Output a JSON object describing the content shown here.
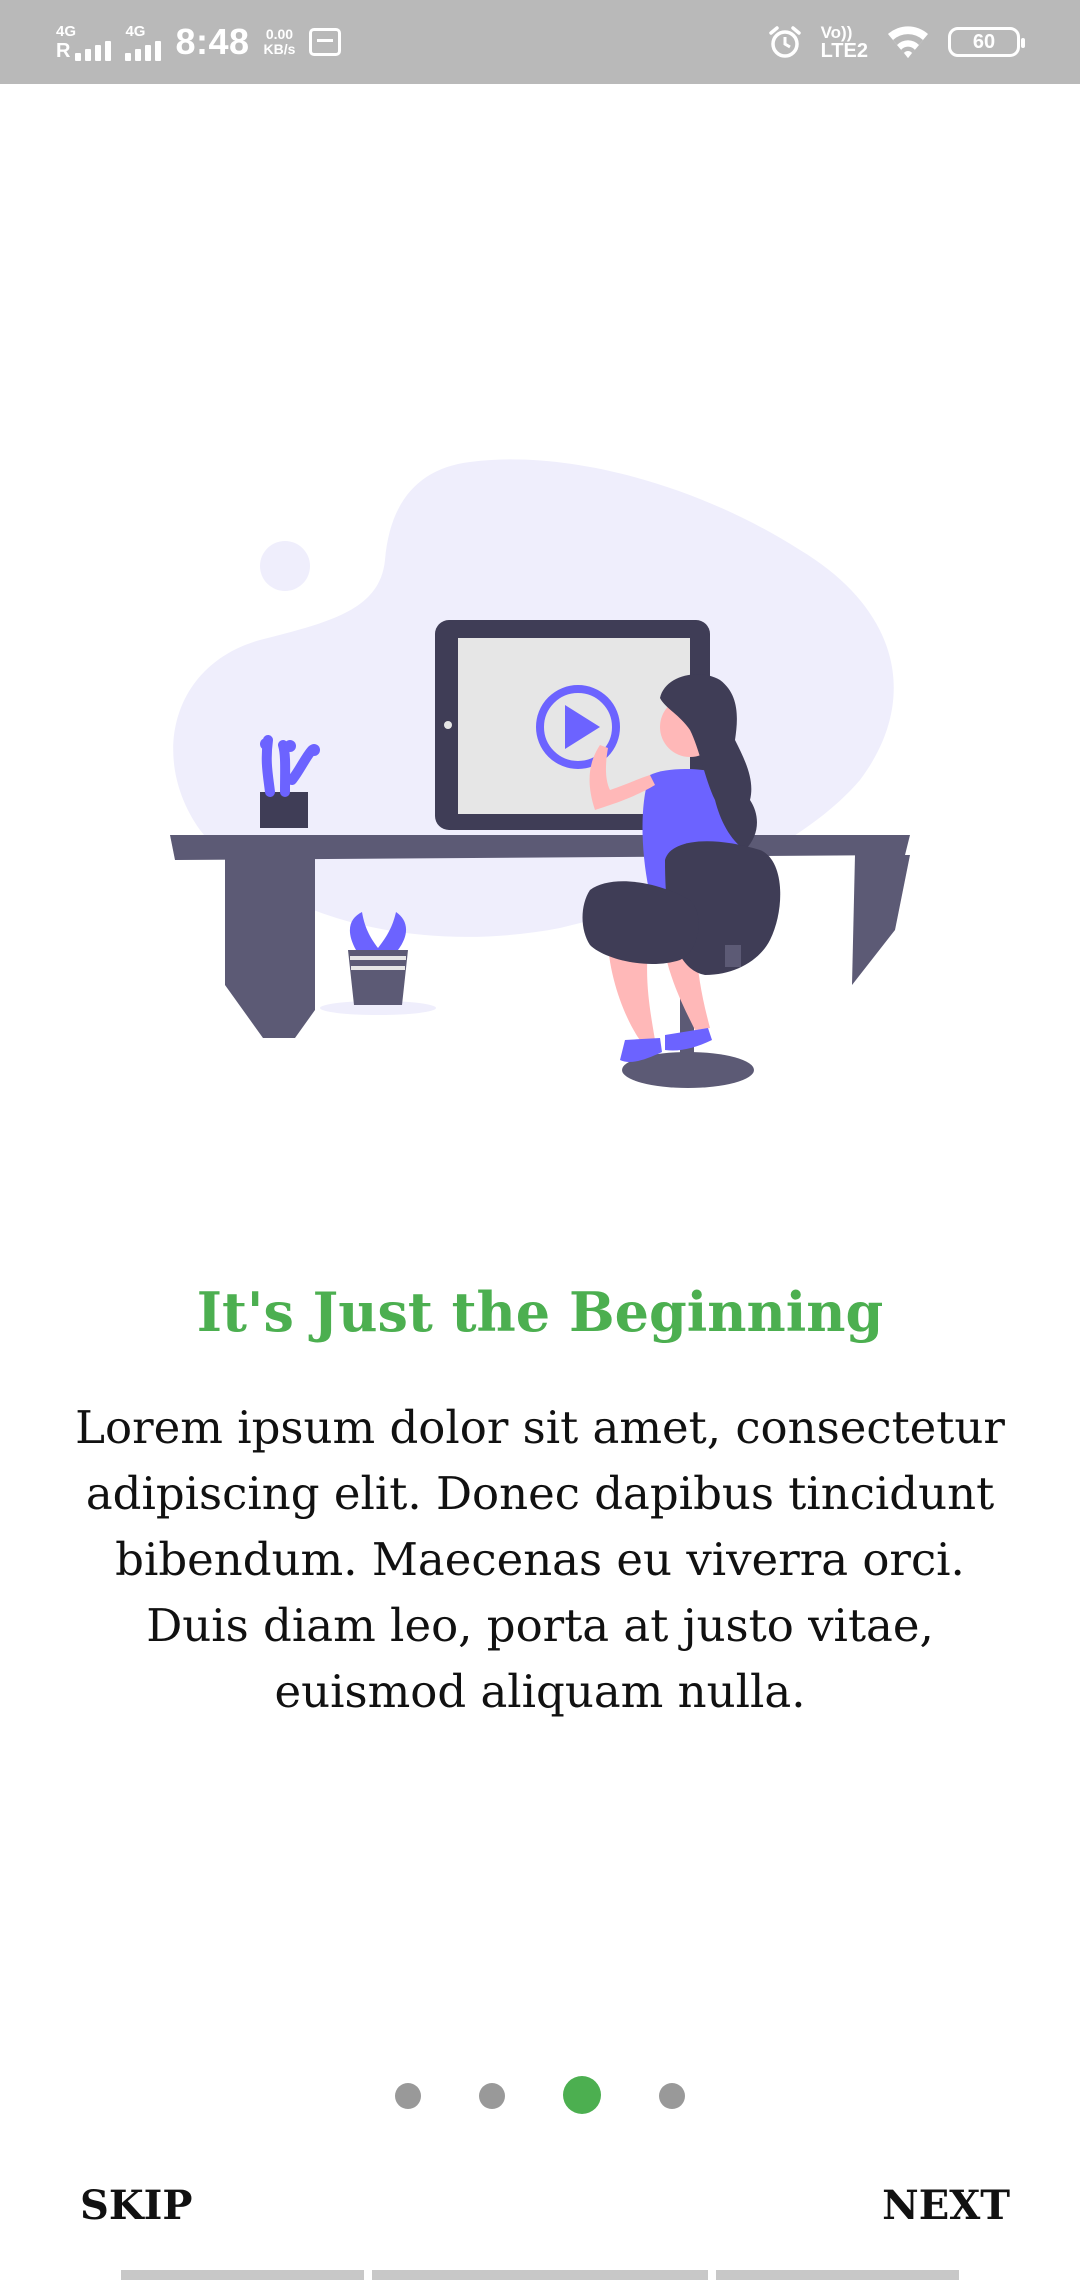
{
  "status_bar": {
    "net1_label": "4G",
    "net1_roaming": "R",
    "net2_label": "4G",
    "time": "8:48",
    "speed_value": "0.00",
    "speed_unit": "KB/s",
    "volte_top": "Vo))",
    "volte_bottom": "LTE2",
    "battery": "60"
  },
  "onboarding": {
    "title": "It's Just the Beginning",
    "body": "Lorem ipsum dolor sit amet, consectetur adipiscing elit. Donec dapibus tincidunt bibendum. Maecenas eu viverra orci. Duis diam leo, porta at justo vitae, euismod aliquam nulla.",
    "page_count": 4,
    "active_page": 3,
    "skip_label": "SKIP",
    "next_label": "NEXT"
  },
  "colors": {
    "accent": "#4caf50",
    "inactive_dot": "#999999",
    "illustration_purple": "#6c63ff",
    "illustration_dark": "#3f3d56"
  },
  "icons": {
    "gallery": "gallery-icon",
    "alarm": "alarm-icon",
    "wifi": "wifi-icon",
    "battery": "battery-icon"
  }
}
